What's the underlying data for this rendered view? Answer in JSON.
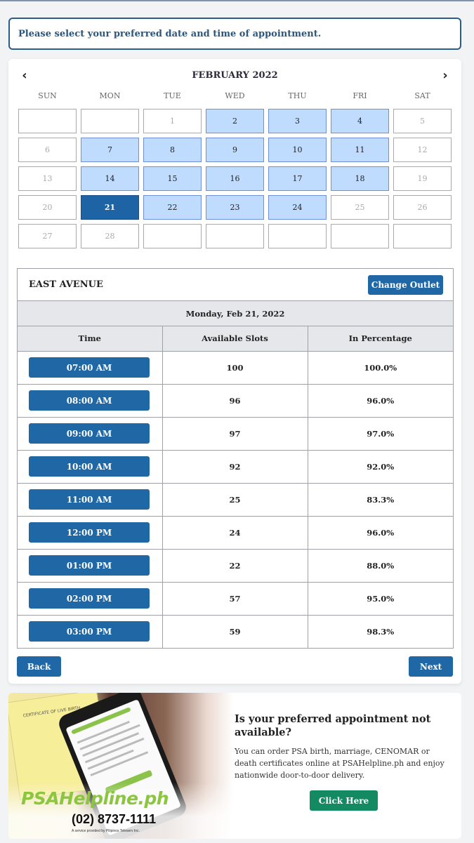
{
  "notice": "Please select your preferred date and time of appointment.",
  "calendar": {
    "title": "FEBRUARY 2022",
    "prev_icon": "‹",
    "next_icon": "›",
    "weekdays": [
      "SUN",
      "MON",
      "TUE",
      "WED",
      "THU",
      "FRI",
      "SAT"
    ],
    "days": [
      {
        "label": "",
        "state": "empty"
      },
      {
        "label": "",
        "state": "empty"
      },
      {
        "label": "1",
        "state": "disabled"
      },
      {
        "label": "2",
        "state": "available"
      },
      {
        "label": "3",
        "state": "available"
      },
      {
        "label": "4",
        "state": "available"
      },
      {
        "label": "5",
        "state": "disabled"
      },
      {
        "label": "6",
        "state": "disabled"
      },
      {
        "label": "7",
        "state": "available"
      },
      {
        "label": "8",
        "state": "available"
      },
      {
        "label": "9",
        "state": "available"
      },
      {
        "label": "10",
        "state": "available"
      },
      {
        "label": "11",
        "state": "available"
      },
      {
        "label": "12",
        "state": "disabled"
      },
      {
        "label": "13",
        "state": "disabled"
      },
      {
        "label": "14",
        "state": "available"
      },
      {
        "label": "15",
        "state": "available"
      },
      {
        "label": "16",
        "state": "available"
      },
      {
        "label": "17",
        "state": "available"
      },
      {
        "label": "18",
        "state": "available"
      },
      {
        "label": "19",
        "state": "disabled"
      },
      {
        "label": "20",
        "state": "disabled"
      },
      {
        "label": "21",
        "state": "selected"
      },
      {
        "label": "22",
        "state": "available"
      },
      {
        "label": "23",
        "state": "available"
      },
      {
        "label": "24",
        "state": "available"
      },
      {
        "label": "25",
        "state": "disabled"
      },
      {
        "label": "26",
        "state": "disabled"
      },
      {
        "label": "27",
        "state": "disabled"
      },
      {
        "label": "28",
        "state": "disabled"
      },
      {
        "label": "",
        "state": "empty"
      },
      {
        "label": "",
        "state": "empty"
      },
      {
        "label": "",
        "state": "empty"
      },
      {
        "label": "",
        "state": "empty"
      },
      {
        "label": "",
        "state": "empty"
      }
    ]
  },
  "slots": {
    "outlet_name": "EAST AVENUE",
    "change_outlet_label": "Change Outlet",
    "selected_date": "Monday, Feb 21, 2022",
    "columns": [
      "Time",
      "Available Slots",
      "In Percentage"
    ],
    "rows": [
      {
        "time": "07:00 AM",
        "available": "100",
        "percentage": "100.0%"
      },
      {
        "time": "08:00 AM",
        "available": "96",
        "percentage": "96.0%"
      },
      {
        "time": "09:00 AM",
        "available": "97",
        "percentage": "97.0%"
      },
      {
        "time": "10:00 AM",
        "available": "92",
        "percentage": "92.0%"
      },
      {
        "time": "11:00 AM",
        "available": "25",
        "percentage": "83.3%"
      },
      {
        "time": "12:00 PM",
        "available": "24",
        "percentage": "96.0%"
      },
      {
        "time": "01:00 PM",
        "available": "22",
        "percentage": "88.0%"
      },
      {
        "time": "02:00 PM",
        "available": "57",
        "percentage": "95.0%"
      },
      {
        "time": "03:00 PM",
        "available": "59",
        "percentage": "98.3%"
      }
    ]
  },
  "footer_buttons": {
    "back": "Back",
    "next": "Next"
  },
  "promo": {
    "image": {
      "certificate_title": "CERTIFICATE OF LIVE BIRTH",
      "brand": "PSAHelpline.ph",
      "phone": "(02) 8737-1111",
      "provided_by": "A service provided by Pilipinos Teleserv Inc."
    },
    "title": "Is your preferred appointment not available?",
    "description": "You can order PSA birth, marriage, CENOMAR or death certificates online at PSAHelpline.ph and enjoy nationwide door-to-door delivery.",
    "cta_label": "Click Here"
  },
  "colors": {
    "primary": "#1f67a5",
    "available_day": "#bfdbfe",
    "selected_day": "#1e64a4",
    "cta_green": "#138a62",
    "brand_green": "#8cc63f"
  }
}
